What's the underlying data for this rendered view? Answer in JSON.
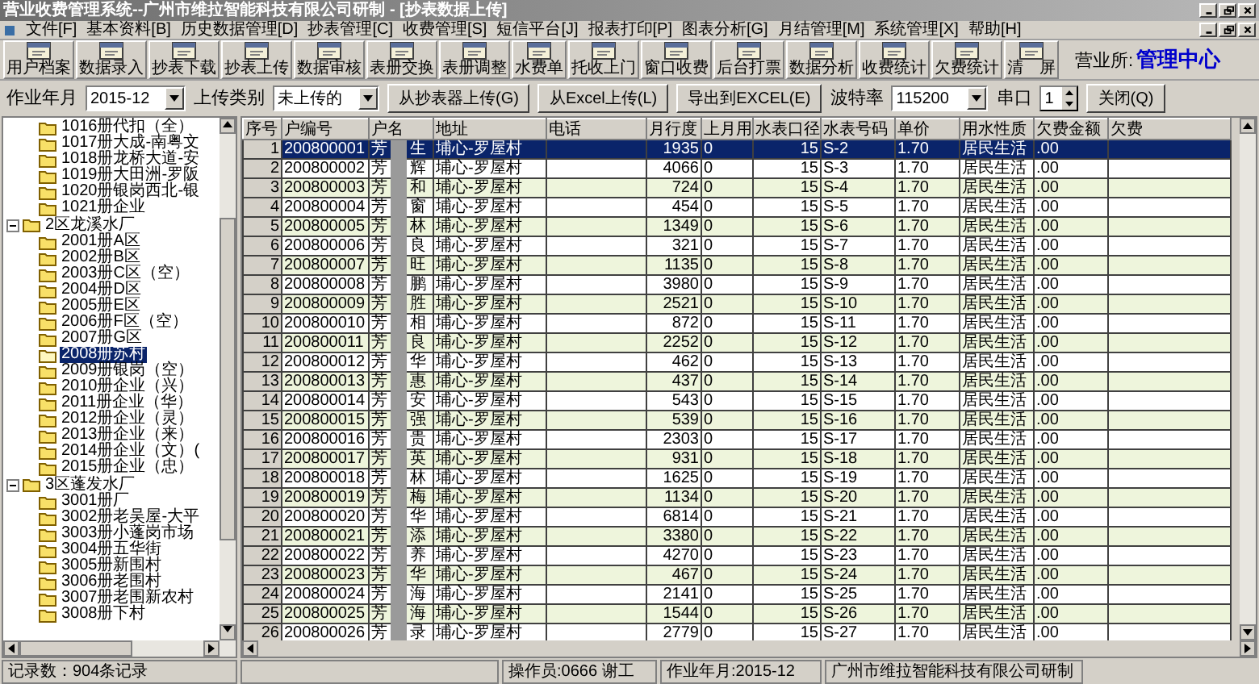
{
  "window": {
    "title": "营业收费管理系统--广州市维拉智能科技有限公司研制 - [抄表数据上传]"
  },
  "menu": [
    "文件[F]",
    "基本资料[B]",
    "历史数据管理[D]",
    "抄表管理[C]",
    "收费管理[S]",
    "短信平台[J]",
    "报表打印[P]",
    "图表分析[G]",
    "月结管理[M]",
    "系统管理[X]",
    "帮助[H]"
  ],
  "toolbar": [
    {
      "label": "用户档案"
    },
    {
      "label": "数据录入"
    },
    {
      "label": "抄表下载"
    },
    {
      "label": "抄表上传"
    },
    {
      "label": "数据审核"
    },
    {
      "label": "表册交换"
    },
    {
      "label": "表册调整"
    },
    {
      "label": "水费单"
    },
    {
      "label": "托收上门"
    },
    {
      "label": "窗口收费"
    },
    {
      "label": "后台打票"
    },
    {
      "label": "数据分析"
    },
    {
      "label": "收费统计"
    },
    {
      "label": "欠费统计"
    },
    {
      "label": "清　屏"
    }
  ],
  "office": {
    "label": "营业所:",
    "value": "管理中心"
  },
  "filters": {
    "period": {
      "label": "作业年月",
      "value": "2015-12"
    },
    "upload_type": {
      "label": "上传类别",
      "value": "未上传的"
    },
    "buttons": [
      "从抄表器上传(G)",
      "从Excel上传(L)",
      "导出到EXCEL(E)"
    ],
    "baud": {
      "label": "波特率",
      "value": "115200"
    },
    "port": {
      "label": "串口",
      "value": "1"
    },
    "close": "关闭(Q)"
  },
  "tree": [
    {
      "children": [
        {
          "label": "1016册代扣（全）",
          "selected": false
        },
        {
          "label": "1017册大成-南粤文",
          "selected": false
        },
        {
          "label": "1018册龙桥大道-安",
          "selected": false
        },
        {
          "label": "1019册大田洲-罗阪",
          "selected": false
        },
        {
          "label": "1020册银岗西北-银",
          "selected": false
        },
        {
          "label": "1021册企业",
          "selected": false
        }
      ]
    },
    {
      "label": "2区龙溪水厂",
      "expanded": true,
      "selected": false,
      "children": [
        {
          "label": "2001册A区",
          "selected": false
        },
        {
          "label": "2002册B区",
          "selected": false
        },
        {
          "label": "2003册C区（空）",
          "selected": false
        },
        {
          "label": "2004册D区",
          "selected": false
        },
        {
          "label": "2005册E区",
          "selected": false
        },
        {
          "label": "2006册F区（空）",
          "selected": false
        },
        {
          "label": "2007册G区",
          "selected": false
        },
        {
          "label": "2008册苏村",
          "selected": true
        },
        {
          "label": "2009册银岗（空）",
          "selected": false
        },
        {
          "label": "2010册企业（兴）",
          "selected": false
        },
        {
          "label": "2011册企业（华）",
          "selected": false
        },
        {
          "label": "2012册企业（灵）",
          "selected": false
        },
        {
          "label": "2013册企业（来）",
          "selected": false
        },
        {
          "label": "2014册企业（文）(",
          "selected": false
        },
        {
          "label": "2015册企业（忠）",
          "selected": false
        }
      ]
    },
    {
      "label": "3区蓬发水厂",
      "expanded": true,
      "selected": false,
      "children": [
        {
          "label": "3001册厂",
          "selected": false
        },
        {
          "label": "3002册老吴屋-大平",
          "selected": false
        },
        {
          "label": "3003册小蓬岗市场",
          "selected": false
        },
        {
          "label": "3004册五华街",
          "selected": false
        },
        {
          "label": "3005册新围村",
          "selected": false
        },
        {
          "label": "3006册老围村",
          "selected": false
        },
        {
          "label": "3007册老围新农村",
          "selected": false
        },
        {
          "label": "3008册下村",
          "selected": false
        }
      ]
    }
  ],
  "table": {
    "columns": [
      "序号",
      "户编号",
      "户名",
      "地址",
      "电话",
      "月行度",
      "上月用",
      "水表口径",
      "水表号码",
      "单价",
      "用水性质",
      "欠费金额",
      "欠费"
    ],
    "rows": [
      {
        "no": "1",
        "id": "200800001",
        "name_start": "芳",
        "name_end": "生",
        "address": "埔心-罗屋村",
        "reading": "1935",
        "last": "0",
        "caliber": "15",
        "meter": "S-2",
        "price": "1.70",
        "usage": "居民生活",
        "arrears": ".00",
        "selected": true
      },
      {
        "no": "2",
        "id": "200800002",
        "name_start": "芳",
        "name_end": "辉",
        "address": "埔心-罗屋村",
        "reading": "4066",
        "last": "0",
        "caliber": "15",
        "meter": "S-3",
        "price": "1.70",
        "usage": "居民生活",
        "arrears": ".00",
        "selected": false
      },
      {
        "no": "3",
        "id": "200800003",
        "name_start": "芳",
        "name_end": "和",
        "address": "埔心-罗屋村",
        "reading": "724",
        "last": "0",
        "caliber": "15",
        "meter": "S-4",
        "price": "1.70",
        "usage": "居民生活",
        "arrears": ".00",
        "selected": false
      },
      {
        "no": "4",
        "id": "200800004",
        "name_start": "芳",
        "name_end": "窗",
        "address": "埔心-罗屋村",
        "reading": "454",
        "last": "0",
        "caliber": "15",
        "meter": "S-5",
        "price": "1.70",
        "usage": "居民生活",
        "arrears": ".00",
        "selected": false
      },
      {
        "no": "5",
        "id": "200800005",
        "name_start": "芳",
        "name_end": "林",
        "address": "埔心-罗屋村",
        "reading": "1349",
        "last": "0",
        "caliber": "15",
        "meter": "S-6",
        "price": "1.70",
        "usage": "居民生活",
        "arrears": ".00",
        "selected": false
      },
      {
        "no": "6",
        "id": "200800006",
        "name_start": "芳",
        "name_end": "良",
        "address": "埔心-罗屋村",
        "reading": "321",
        "last": "0",
        "caliber": "15",
        "meter": "S-7",
        "price": "1.70",
        "usage": "居民生活",
        "arrears": ".00",
        "selected": false
      },
      {
        "no": "7",
        "id": "200800007",
        "name_start": "芳",
        "name_end": "旺",
        "address": "埔心-罗屋村",
        "reading": "1135",
        "last": "0",
        "caliber": "15",
        "meter": "S-8",
        "price": "1.70",
        "usage": "居民生活",
        "arrears": ".00",
        "selected": false
      },
      {
        "no": "8",
        "id": "200800008",
        "name_start": "芳",
        "name_end": "鹏",
        "address": "埔心-罗屋村",
        "reading": "3980",
        "last": "0",
        "caliber": "15",
        "meter": "S-9",
        "price": "1.70",
        "usage": "居民生活",
        "arrears": ".00",
        "selected": false
      },
      {
        "no": "9",
        "id": "200800009",
        "name_start": "芳",
        "name_end": "胜",
        "address": "埔心-罗屋村",
        "reading": "2521",
        "last": "0",
        "caliber": "15",
        "meter": "S-10",
        "price": "1.70",
        "usage": "居民生活",
        "arrears": ".00",
        "selected": false
      },
      {
        "no": "10",
        "id": "200800010",
        "name_start": "芳",
        "name_end": "相",
        "address": "埔心-罗屋村",
        "reading": "872",
        "last": "0",
        "caliber": "15",
        "meter": "S-11",
        "price": "1.70",
        "usage": "居民生活",
        "arrears": ".00",
        "selected": false
      },
      {
        "no": "11",
        "id": "200800011",
        "name_start": "芳",
        "name_end": "良",
        "address": "埔心-罗屋村",
        "reading": "2252",
        "last": "0",
        "caliber": "15",
        "meter": "S-12",
        "price": "1.70",
        "usage": "居民生活",
        "arrears": ".00",
        "selected": false
      },
      {
        "no": "12",
        "id": "200800012",
        "name_start": "芳",
        "name_end": "华",
        "address": "埔心-罗屋村",
        "reading": "462",
        "last": "0",
        "caliber": "15",
        "meter": "S-13",
        "price": "1.70",
        "usage": "居民生活",
        "arrears": ".00",
        "selected": false
      },
      {
        "no": "13",
        "id": "200800013",
        "name_start": "芳",
        "name_end": "惠",
        "address": "埔心-罗屋村",
        "reading": "437",
        "last": "0",
        "caliber": "15",
        "meter": "S-14",
        "price": "1.70",
        "usage": "居民生活",
        "arrears": ".00",
        "selected": false
      },
      {
        "no": "14",
        "id": "200800014",
        "name_start": "芳",
        "name_end": "安",
        "address": "埔心-罗屋村",
        "reading": "543",
        "last": "0",
        "caliber": "15",
        "meter": "S-15",
        "price": "1.70",
        "usage": "居民生活",
        "arrears": ".00",
        "selected": false
      },
      {
        "no": "15",
        "id": "200800015",
        "name_start": "芳",
        "name_end": "强",
        "address": "埔心-罗屋村",
        "reading": "539",
        "last": "0",
        "caliber": "15",
        "meter": "S-16",
        "price": "1.70",
        "usage": "居民生活",
        "arrears": ".00",
        "selected": false
      },
      {
        "no": "16",
        "id": "200800016",
        "name_start": "芳",
        "name_end": "贵",
        "address": "埔心-罗屋村",
        "reading": "2303",
        "last": "0",
        "caliber": "15",
        "meter": "S-17",
        "price": "1.70",
        "usage": "居民生活",
        "arrears": ".00",
        "selected": false
      },
      {
        "no": "17",
        "id": "200800017",
        "name_start": "芳",
        "name_end": "英",
        "address": "埔心-罗屋村",
        "reading": "931",
        "last": "0",
        "caliber": "15",
        "meter": "S-18",
        "price": "1.70",
        "usage": "居民生活",
        "arrears": ".00",
        "selected": false
      },
      {
        "no": "18",
        "id": "200800018",
        "name_start": "芳",
        "name_end": "林",
        "address": "埔心-罗屋村",
        "reading": "1625",
        "last": "0",
        "caliber": "15",
        "meter": "S-19",
        "price": "1.70",
        "usage": "居民生活",
        "arrears": ".00",
        "selected": false
      },
      {
        "no": "19",
        "id": "200800019",
        "name_start": "芳",
        "name_end": "梅",
        "address": "埔心-罗屋村",
        "reading": "1134",
        "last": "0",
        "caliber": "15",
        "meter": "S-20",
        "price": "1.70",
        "usage": "居民生活",
        "arrears": ".00",
        "selected": false
      },
      {
        "no": "20",
        "id": "200800020",
        "name_start": "芳",
        "name_end": "华",
        "address": "埔心-罗屋村",
        "reading": "6814",
        "last": "0",
        "caliber": "15",
        "meter": "S-21",
        "price": "1.70",
        "usage": "居民生活",
        "arrears": ".00",
        "selected": false
      },
      {
        "no": "21",
        "id": "200800021",
        "name_start": "芳",
        "name_end": "添",
        "address": "埔心-罗屋村",
        "reading": "3380",
        "last": "0",
        "caliber": "15",
        "meter": "S-22",
        "price": "1.70",
        "usage": "居民生活",
        "arrears": ".00",
        "selected": false
      },
      {
        "no": "22",
        "id": "200800022",
        "name_start": "芳",
        "name_end": "养",
        "address": "埔心-罗屋村",
        "reading": "4270",
        "last": "0",
        "caliber": "15",
        "meter": "S-23",
        "price": "1.70",
        "usage": "居民生活",
        "arrears": ".00",
        "selected": false
      },
      {
        "no": "23",
        "id": "200800023",
        "name_start": "芳",
        "name_end": "华",
        "address": "埔心-罗屋村",
        "reading": "467",
        "last": "0",
        "caliber": "15",
        "meter": "S-24",
        "price": "1.70",
        "usage": "居民生活",
        "arrears": ".00",
        "selected": false
      },
      {
        "no": "24",
        "id": "200800024",
        "name_start": "芳",
        "name_end": "海",
        "address": "埔心-罗屋村",
        "reading": "2141",
        "last": "0",
        "caliber": "15",
        "meter": "S-25",
        "price": "1.70",
        "usage": "居民生活",
        "arrears": ".00",
        "selected": false
      },
      {
        "no": "25",
        "id": "200800025",
        "name_start": "芳",
        "name_end": "海",
        "address": "埔心-罗屋村",
        "reading": "1544",
        "last": "0",
        "caliber": "15",
        "meter": "S-26",
        "price": "1.70",
        "usage": "居民生活",
        "arrears": ".00",
        "selected": false
      },
      {
        "no": "26",
        "id": "200800026",
        "name_start": "芳",
        "name_end": "录",
        "address": "埔心-罗屋村",
        "reading": "2779",
        "last": "0",
        "caliber": "15",
        "meter": "S-27",
        "price": "1.70",
        "usage": "居民生活",
        "arrears": ".00",
        "selected": false
      }
    ]
  },
  "status_bar": {
    "records": "记录数：904条记录",
    "operator": "操作员:0666 谢工",
    "period": "作业年月:2015-12",
    "credit": "广州市维拉智能科技有限公司研制"
  }
}
